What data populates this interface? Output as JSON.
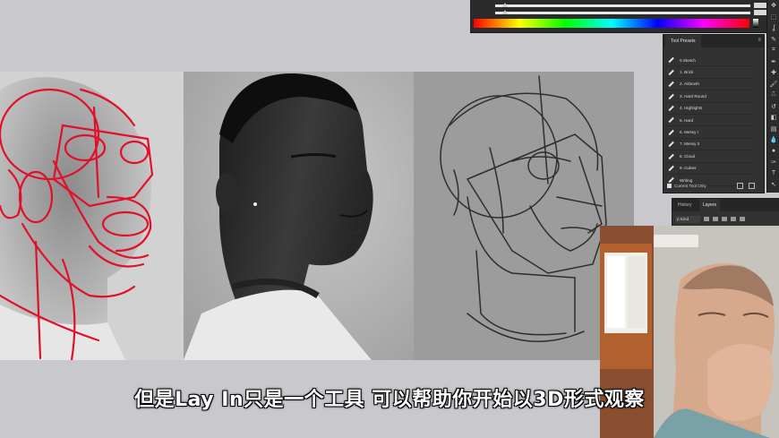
{
  "subtitle": "但是Lay In只是一个工具 可以帮助你开始以3D形式观察",
  "tool_presets": {
    "tab_label": "Tool Presets",
    "items": [
      "0.Sketch",
      "1. Brick",
      "2. Airbrush",
      "3. Hard Round",
      "4. Highlights",
      "5. Hard",
      "6. Messy I",
      "7. Messy II",
      "8. Cloud",
      "9. Cubes",
      "Writing"
    ],
    "current_tool_only_label": "Current Tool Only"
  },
  "layers_panel": {
    "tab_history": "History",
    "tab_layers": "Layers",
    "kind_filter": "ρ Kind"
  },
  "color_panel": {
    "spectrum": "hue spectrum"
  },
  "colors": {
    "ps_panel": "#323232",
    "overlay_lines": "#e0102a",
    "canvas_bg": "#c9c8cd"
  },
  "icons": {
    "tools": [
      "move-icon",
      "marquee-icon",
      "lasso-icon",
      "quick-select-icon",
      "crop-icon",
      "eyedropper-icon",
      "healing-icon",
      "brush-icon",
      "stamp-icon",
      "history-brush-icon",
      "eraser-icon",
      "gradient-icon",
      "blur-icon",
      "dodge-icon",
      "pen-icon",
      "type-icon",
      "path-select-icon"
    ],
    "tool_glyphs": [
      "✥",
      "⬚",
      "ʆ",
      "✎",
      "⌗",
      "✒",
      "✚",
      "🖌",
      "⎍",
      "↺",
      "◧",
      "▤",
      "💧",
      "●",
      "✑",
      "T",
      "↖"
    ]
  }
}
